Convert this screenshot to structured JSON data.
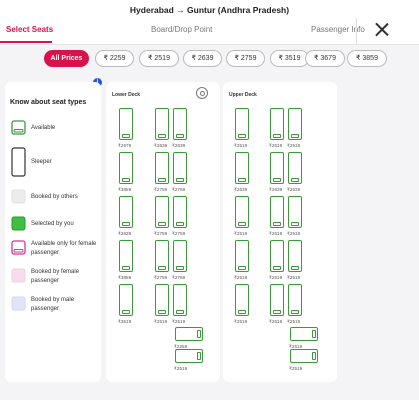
{
  "header": {
    "route": "Hyderabad → Guntur (Andhra Pradesh)",
    "tabs": [
      {
        "label": "Select Seats",
        "active": true
      },
      {
        "label": "Board/Drop Point",
        "active": false
      },
      {
        "label": "Passenger Info",
        "active": false
      }
    ]
  },
  "price_filters": [
    "All Prices",
    "₹ 2259",
    "₹ 2519",
    "₹ 2639",
    "₹ 2759",
    "₹ 3519",
    "₹ 3679",
    "₹ 3859"
  ],
  "legend": {
    "title": "Know about seat types",
    "info": "i",
    "items": [
      {
        "label": "Available",
        "icon": "available-seat-icon"
      },
      {
        "label": "Sleeper",
        "icon": "sleeper-seat-icon"
      },
      {
        "label": "Booked by others",
        "icon": "booked-seat-icon"
      },
      {
        "label": "Selected by you",
        "icon": "selected-seat-icon"
      },
      {
        "label": "Available only for female passenger",
        "icon": "female-available-icon"
      },
      {
        "label": "Booked by female passenger",
        "icon": "female-booked-icon"
      },
      {
        "label": "Booked by male passenger",
        "icon": "male-booked-icon"
      }
    ]
  },
  "decks": {
    "lower": {
      "title": "Lower Deck",
      "rows": [
        [
          "₹2679",
          "₹2639",
          "₹2639"
        ],
        [
          "₹3859",
          "₹2759",
          "₹2759"
        ],
        [
          "₹2639",
          "₹2759",
          "₹2759"
        ],
        [
          "₹3859",
          "₹2759",
          "₹2759"
        ],
        [
          "₹3519",
          "₹2519",
          "₹2519"
        ]
      ],
      "sleepers": [
        "₹2259",
        "₹2519"
      ]
    },
    "upper": {
      "title": "Upper Deck",
      "rows": [
        [
          "₹2519",
          "₹2519",
          "₹2519"
        ],
        [
          "₹2639",
          "₹2639",
          "₹2639"
        ],
        [
          "₹2519",
          "₹2519",
          "₹2519"
        ],
        [
          "₹2519",
          "₹2519",
          "₹2519"
        ],
        [
          "₹2519",
          "₹2519",
          "₹2519"
        ]
      ],
      "sleepers": [
        "₹2519",
        "₹2519"
      ]
    }
  },
  "colors": {
    "accent": "#d8134b",
    "available": "#3a9a3a",
    "selected": "#3fbf3f",
    "female": "#d3359c",
    "info": "#2b55d6"
  }
}
